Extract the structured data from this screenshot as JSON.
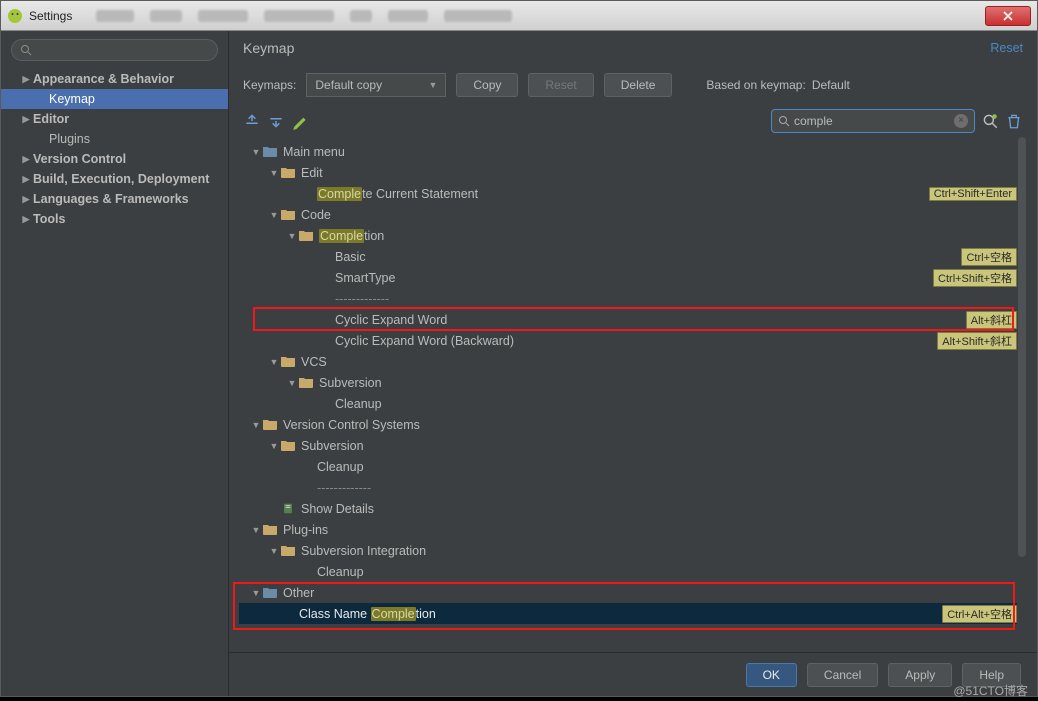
{
  "window": {
    "title": "Settings"
  },
  "sidebar": {
    "items": [
      {
        "label": "Appearance & Behavior",
        "expandable": true,
        "bold": true
      },
      {
        "label": "Keymap",
        "child": true,
        "selected": true
      },
      {
        "label": "Editor",
        "expandable": true,
        "bold": true
      },
      {
        "label": "Plugins",
        "child": true
      },
      {
        "label": "Version Control",
        "expandable": true,
        "bold": true
      },
      {
        "label": "Build, Execution, Deployment",
        "expandable": true,
        "bold": true
      },
      {
        "label": "Languages & Frameworks",
        "expandable": true,
        "bold": true
      },
      {
        "label": "Tools",
        "expandable": true,
        "bold": true
      }
    ]
  },
  "header": {
    "title": "Keymap",
    "reset": "Reset"
  },
  "keymap_row": {
    "label": "Keymaps:",
    "selected": "Default copy",
    "copy": "Copy",
    "reset": "Reset",
    "delete": "Delete",
    "based_label": "Based on keymap:",
    "based_value": "Default"
  },
  "filter": {
    "value": "comple"
  },
  "tree": {
    "items": [
      {
        "depth": 0,
        "arrow": "▼",
        "icon": "folder-group",
        "label": "Main menu"
      },
      {
        "depth": 1,
        "arrow": "▼",
        "icon": "folder",
        "label": "Edit"
      },
      {
        "depth": 2,
        "label_pre": "",
        "hl": "Comple",
        "label_post": "te Current Statement",
        "shortcut": "Ctrl+Shift+Enter"
      },
      {
        "depth": 1,
        "arrow": "▼",
        "icon": "folder",
        "label": "Code"
      },
      {
        "depth": 2,
        "arrow": "▼",
        "icon": "folder",
        "label_pre": "",
        "hl": "Comple",
        "label_post": "tion"
      },
      {
        "depth": 3,
        "label": "Basic",
        "shortcut": "Ctrl+空格"
      },
      {
        "depth": 3,
        "label": "SmartType",
        "shortcut": "Ctrl+Shift+空格"
      },
      {
        "depth": 3,
        "sep": true
      },
      {
        "depth": 3,
        "label": "Cyclic Expand Word",
        "shortcut": "Alt+斜杠"
      },
      {
        "depth": 3,
        "label": "Cyclic Expand Word (Backward)",
        "shortcut": "Alt+Shift+斜杠"
      },
      {
        "depth": 1,
        "arrow": "▼",
        "icon": "folder",
        "label": "VCS"
      },
      {
        "depth": 2,
        "arrow": "▼",
        "icon": "folder",
        "label": "Subversion"
      },
      {
        "depth": 3,
        "label": "Cleanup"
      },
      {
        "depth": 0,
        "arrow": "▼",
        "icon": "folder",
        "label": "Version Control Systems"
      },
      {
        "depth": 1,
        "arrow": "▼",
        "icon": "folder",
        "label": "Subversion"
      },
      {
        "depth": 2,
        "label": "Cleanup"
      },
      {
        "depth": 2,
        "sep": true
      },
      {
        "depth": 1,
        "icon": "doc",
        "label": "Show Details"
      },
      {
        "depth": 0,
        "arrow": "▼",
        "icon": "folder",
        "label": "Plug-ins"
      },
      {
        "depth": 1,
        "arrow": "▼",
        "icon": "folder",
        "label": "Subversion Integration"
      },
      {
        "depth": 2,
        "label": "Cleanup"
      },
      {
        "depth": 0,
        "arrow": "▼",
        "icon": "folder-group",
        "label": "Other"
      },
      {
        "depth": 1,
        "label_pre": "Class Name ",
        "hl": "Comple",
        "label_post": "tion",
        "shortcut": "Ctrl+Alt+空格",
        "selected": true
      }
    ]
  },
  "footer": {
    "ok": "OK",
    "cancel": "Cancel",
    "apply": "Apply",
    "help": "Help"
  },
  "watermark": "@51CTO博客"
}
